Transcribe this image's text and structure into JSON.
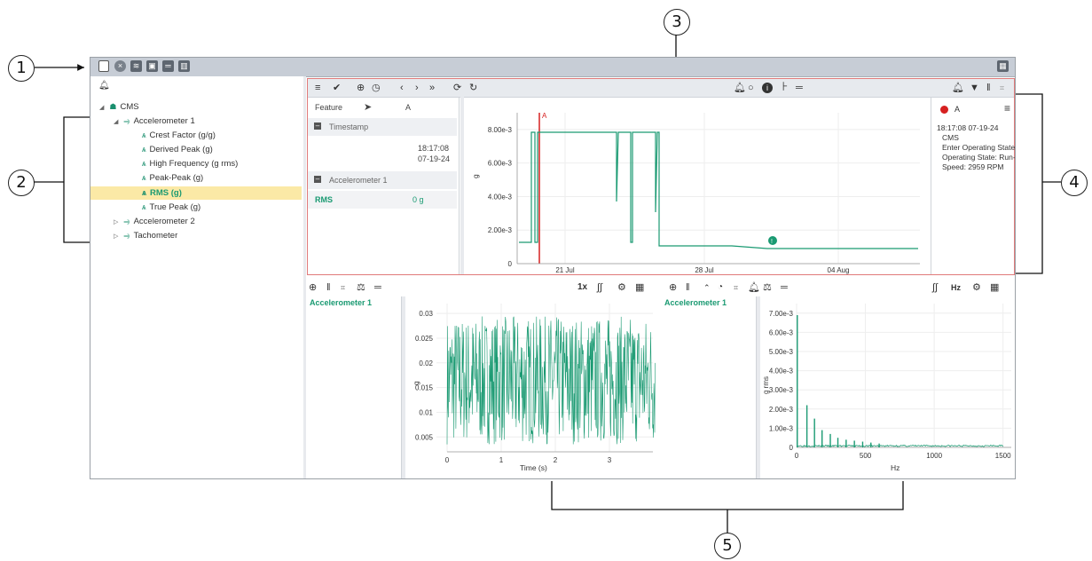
{
  "callouts": [
    "1",
    "2",
    "3",
    "4",
    "5"
  ],
  "colors": {
    "accent_green": "#1a9a72",
    "marker_red": "#d62020",
    "selection": "#fbe9a6",
    "toolbar": "#e7eaee"
  },
  "tree": {
    "root_label": "CMS",
    "items": [
      {
        "label": "Accelerometer 1",
        "icon": "sensor-icon"
      },
      {
        "label": "Crest Factor (g/g)",
        "icon": "feature-icon"
      },
      {
        "label": "Derived Peak (g)",
        "icon": "feature-icon"
      },
      {
        "label": "High Frequency (g rms)",
        "icon": "feature-icon"
      },
      {
        "label": "Peak-Peak (g)",
        "icon": "feature-icon"
      },
      {
        "label": "RMS (g)",
        "icon": "feature-icon",
        "selected": true
      },
      {
        "label": "True Peak (g)",
        "icon": "feature-icon"
      },
      {
        "label": "Accelerometer 2",
        "icon": "sensor-icon"
      },
      {
        "label": "Tachometer",
        "icon": "sensor-icon"
      }
    ]
  },
  "feature_table": {
    "col_feature": "Feature",
    "col_a": "A",
    "timestamp_label": "Timestamp",
    "timestamp_time": "18:17:08",
    "timestamp_date": "07-19-24",
    "section_label": "Accelerometer 1",
    "row_label": "RMS",
    "row_value": "0 g"
  },
  "events": {
    "marker_label": "A",
    "time": "18:17:08 07-19-24",
    "lines": [
      "CMS",
      "Enter Operating State",
      "Operating State: Run-",
      "Speed: 2959 RPM"
    ]
  },
  "trend_chart": {
    "chart_data": {
      "type": "line",
      "ylabel": "g",
      "y_ticks": [
        "0",
        "2.00e-3",
        "4.00e-3",
        "6.00e-3",
        "8.00e-3"
      ],
      "x_ticks": [
        "21 Jul",
        "28 Jul",
        "04 Aug"
      ],
      "marker": "A",
      "series": [
        {
          "values_approx_g": [
            0.0013,
            0.008,
            0.008,
            0.0013,
            0.008,
            0.0013,
            0.008,
            0.0013,
            0.0012
          ]
        }
      ]
    }
  },
  "waveform": {
    "title": "Accelerometer 1",
    "toolbar_speed": "1x",
    "chart_data": {
      "type": "line",
      "xlabel": "Time (s)",
      "ylabel": "g",
      "x_ticks": [
        "0",
        "1",
        "2",
        "3"
      ],
      "y_ticks": [
        "0.005",
        "0.01",
        "0.015",
        "0.02",
        "0.025",
        "0.03"
      ],
      "ylim": [
        0.002,
        0.032
      ]
    }
  },
  "spectrum": {
    "title": "Accelerometer 1",
    "toolbar_unit": "Hz",
    "chart_data": {
      "type": "bar",
      "xlabel": "Hz",
      "ylabel": "g rms",
      "x_ticks": [
        "0",
        "500",
        "1000",
        "1500"
      ],
      "y_ticks": [
        "0",
        "1.00e-3",
        "2.00e-3",
        "3.00e-3",
        "4.00e-3",
        "5.00e-3",
        "6.00e-3",
        "7.00e-3"
      ],
      "peaks": [
        {
          "hz": 5,
          "g": 0.0069
        },
        {
          "hz": 75,
          "g": 0.0022
        },
        {
          "hz": 130,
          "g": 0.0015
        },
        {
          "hz": 185,
          "g": 0.0009
        },
        {
          "hz": 245,
          "g": 0.0007
        },
        {
          "hz": 300,
          "g": 0.0005
        },
        {
          "hz": 360,
          "g": 0.0004
        },
        {
          "hz": 420,
          "g": 0.00035
        },
        {
          "hz": 480,
          "g": 0.0003
        },
        {
          "hz": 540,
          "g": 0.00025
        },
        {
          "hz": 600,
          "g": 0.0002
        }
      ]
    }
  }
}
